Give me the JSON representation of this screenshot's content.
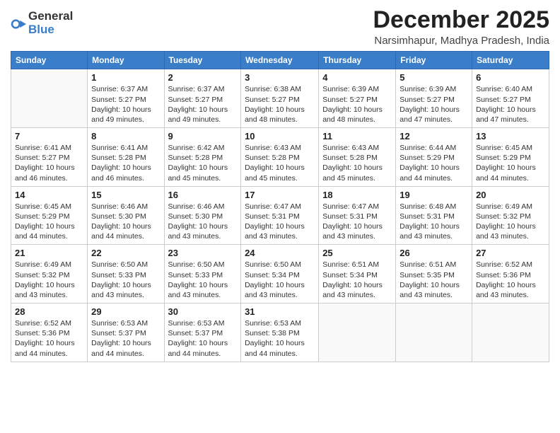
{
  "logo": {
    "general": "General",
    "blue": "Blue"
  },
  "title": "December 2025",
  "subtitle": "Narsimhapur, Madhya Pradesh, India",
  "days_header": [
    "Sunday",
    "Monday",
    "Tuesday",
    "Wednesday",
    "Thursday",
    "Friday",
    "Saturday"
  ],
  "weeks": [
    [
      {
        "day": "",
        "info": ""
      },
      {
        "day": "1",
        "info": "Sunrise: 6:37 AM\nSunset: 5:27 PM\nDaylight: 10 hours and 49 minutes."
      },
      {
        "day": "2",
        "info": "Sunrise: 6:37 AM\nSunset: 5:27 PM\nDaylight: 10 hours and 49 minutes."
      },
      {
        "day": "3",
        "info": "Sunrise: 6:38 AM\nSunset: 5:27 PM\nDaylight: 10 hours and 48 minutes."
      },
      {
        "day": "4",
        "info": "Sunrise: 6:39 AM\nSunset: 5:27 PM\nDaylight: 10 hours and 48 minutes."
      },
      {
        "day": "5",
        "info": "Sunrise: 6:39 AM\nSunset: 5:27 PM\nDaylight: 10 hours and 47 minutes."
      },
      {
        "day": "6",
        "info": "Sunrise: 6:40 AM\nSunset: 5:27 PM\nDaylight: 10 hours and 47 minutes."
      }
    ],
    [
      {
        "day": "7",
        "info": "Sunrise: 6:41 AM\nSunset: 5:27 PM\nDaylight: 10 hours and 46 minutes."
      },
      {
        "day": "8",
        "info": "Sunrise: 6:41 AM\nSunset: 5:28 PM\nDaylight: 10 hours and 46 minutes."
      },
      {
        "day": "9",
        "info": "Sunrise: 6:42 AM\nSunset: 5:28 PM\nDaylight: 10 hours and 45 minutes."
      },
      {
        "day": "10",
        "info": "Sunrise: 6:43 AM\nSunset: 5:28 PM\nDaylight: 10 hours and 45 minutes."
      },
      {
        "day": "11",
        "info": "Sunrise: 6:43 AM\nSunset: 5:28 PM\nDaylight: 10 hours and 45 minutes."
      },
      {
        "day": "12",
        "info": "Sunrise: 6:44 AM\nSunset: 5:29 PM\nDaylight: 10 hours and 44 minutes."
      },
      {
        "day": "13",
        "info": "Sunrise: 6:45 AM\nSunset: 5:29 PM\nDaylight: 10 hours and 44 minutes."
      }
    ],
    [
      {
        "day": "14",
        "info": "Sunrise: 6:45 AM\nSunset: 5:29 PM\nDaylight: 10 hours and 44 minutes."
      },
      {
        "day": "15",
        "info": "Sunrise: 6:46 AM\nSunset: 5:30 PM\nDaylight: 10 hours and 44 minutes."
      },
      {
        "day": "16",
        "info": "Sunrise: 6:46 AM\nSunset: 5:30 PM\nDaylight: 10 hours and 43 minutes."
      },
      {
        "day": "17",
        "info": "Sunrise: 6:47 AM\nSunset: 5:31 PM\nDaylight: 10 hours and 43 minutes."
      },
      {
        "day": "18",
        "info": "Sunrise: 6:47 AM\nSunset: 5:31 PM\nDaylight: 10 hours and 43 minutes."
      },
      {
        "day": "19",
        "info": "Sunrise: 6:48 AM\nSunset: 5:31 PM\nDaylight: 10 hours and 43 minutes."
      },
      {
        "day": "20",
        "info": "Sunrise: 6:49 AM\nSunset: 5:32 PM\nDaylight: 10 hours and 43 minutes."
      }
    ],
    [
      {
        "day": "21",
        "info": "Sunrise: 6:49 AM\nSunset: 5:32 PM\nDaylight: 10 hours and 43 minutes."
      },
      {
        "day": "22",
        "info": "Sunrise: 6:50 AM\nSunset: 5:33 PM\nDaylight: 10 hours and 43 minutes."
      },
      {
        "day": "23",
        "info": "Sunrise: 6:50 AM\nSunset: 5:33 PM\nDaylight: 10 hours and 43 minutes."
      },
      {
        "day": "24",
        "info": "Sunrise: 6:50 AM\nSunset: 5:34 PM\nDaylight: 10 hours and 43 minutes."
      },
      {
        "day": "25",
        "info": "Sunrise: 6:51 AM\nSunset: 5:34 PM\nDaylight: 10 hours and 43 minutes."
      },
      {
        "day": "26",
        "info": "Sunrise: 6:51 AM\nSunset: 5:35 PM\nDaylight: 10 hours and 43 minutes."
      },
      {
        "day": "27",
        "info": "Sunrise: 6:52 AM\nSunset: 5:36 PM\nDaylight: 10 hours and 43 minutes."
      }
    ],
    [
      {
        "day": "28",
        "info": "Sunrise: 6:52 AM\nSunset: 5:36 PM\nDaylight: 10 hours and 44 minutes."
      },
      {
        "day": "29",
        "info": "Sunrise: 6:53 AM\nSunset: 5:37 PM\nDaylight: 10 hours and 44 minutes."
      },
      {
        "day": "30",
        "info": "Sunrise: 6:53 AM\nSunset: 5:37 PM\nDaylight: 10 hours and 44 minutes."
      },
      {
        "day": "31",
        "info": "Sunrise: 6:53 AM\nSunset: 5:38 PM\nDaylight: 10 hours and 44 minutes."
      },
      {
        "day": "",
        "info": ""
      },
      {
        "day": "",
        "info": ""
      },
      {
        "day": "",
        "info": ""
      }
    ]
  ]
}
